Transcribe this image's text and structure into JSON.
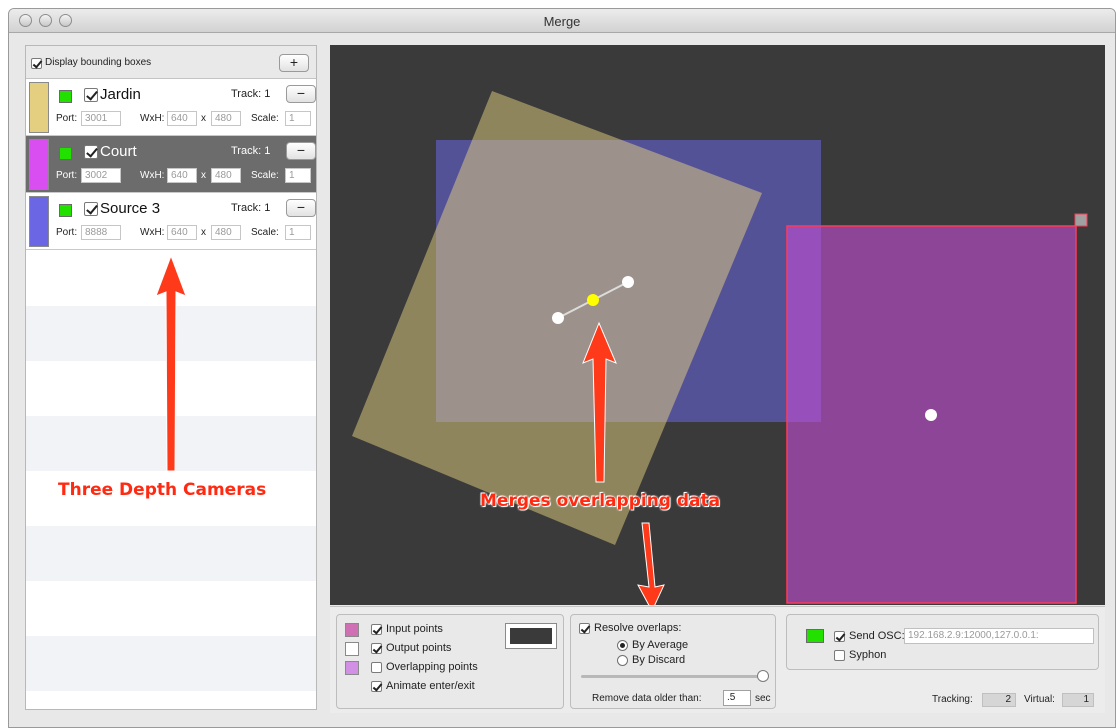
{
  "window": {
    "title": "Merge"
  },
  "left_panel": {
    "display_bbox_label": "Display bounding boxes",
    "add_button": "+",
    "remove_button": "−",
    "labels": {
      "port": "Port:",
      "wxh": "WxH:",
      "x": "x",
      "scale": "Scale:"
    },
    "cameras": [
      {
        "name": "Jardin",
        "track": "Track: 1",
        "port": "3001",
        "width": "640",
        "height": "480",
        "scale": "1",
        "color": "#e4cf80",
        "selected": false
      },
      {
        "name": "Court",
        "track": "Track: 1",
        "port": "3002",
        "width": "640",
        "height": "480",
        "scale": "1",
        "color": "#d84ef0",
        "selected": true
      },
      {
        "name": "Source 3",
        "track": "Track: 1",
        "port": "8888",
        "width": "640",
        "height": "480",
        "scale": "1",
        "color": "#6a66e4",
        "selected": false
      }
    ]
  },
  "annotations": {
    "cameras": "Three Depth Cameras",
    "merge": "Merges overlapping data"
  },
  "bottom_bar": {
    "points": {
      "input_label": "Input points",
      "output_label": "Output points",
      "overlapping_label": "Overlapping points",
      "animate_label": "Animate enter/exit",
      "input_color": "#d070b4",
      "output_color": "#ffffff",
      "overlapping_color": "#d290e4",
      "bg_color": "#3a3a3a"
    },
    "resolve": {
      "label": "Resolve overlaps:",
      "by_average": "By Average",
      "by_discard": "By Discard",
      "remove_label": "Remove data older than:",
      "remove_value": ".5",
      "remove_unit": "sec"
    },
    "osc": {
      "send_label": "Send OSC:",
      "address": "192.168.2.9:12000,127.0.0.1:",
      "syphon_label": "Syphon",
      "tracking_label": "Tracking:",
      "tracking_value": "2",
      "virtual_label": "Virtual:",
      "virtual_value": "1"
    }
  }
}
